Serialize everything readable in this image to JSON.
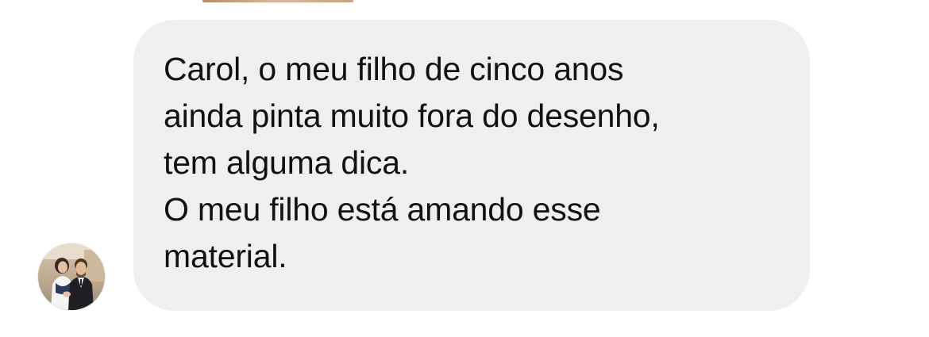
{
  "message": {
    "paragraphs": [
      {
        "lines": [
          "Carol, o meu filho de cinco anos",
          "ainda pinta muito fora do desenho,",
          "tem alguma dica."
        ]
      },
      {
        "lines": [
          "O meu filho está amando esse",
          "material."
        ]
      }
    ],
    "bubble_color": "#efefef",
    "text_color": "#111111"
  },
  "sender": {
    "avatar_icon": "profile-photo-icon"
  }
}
